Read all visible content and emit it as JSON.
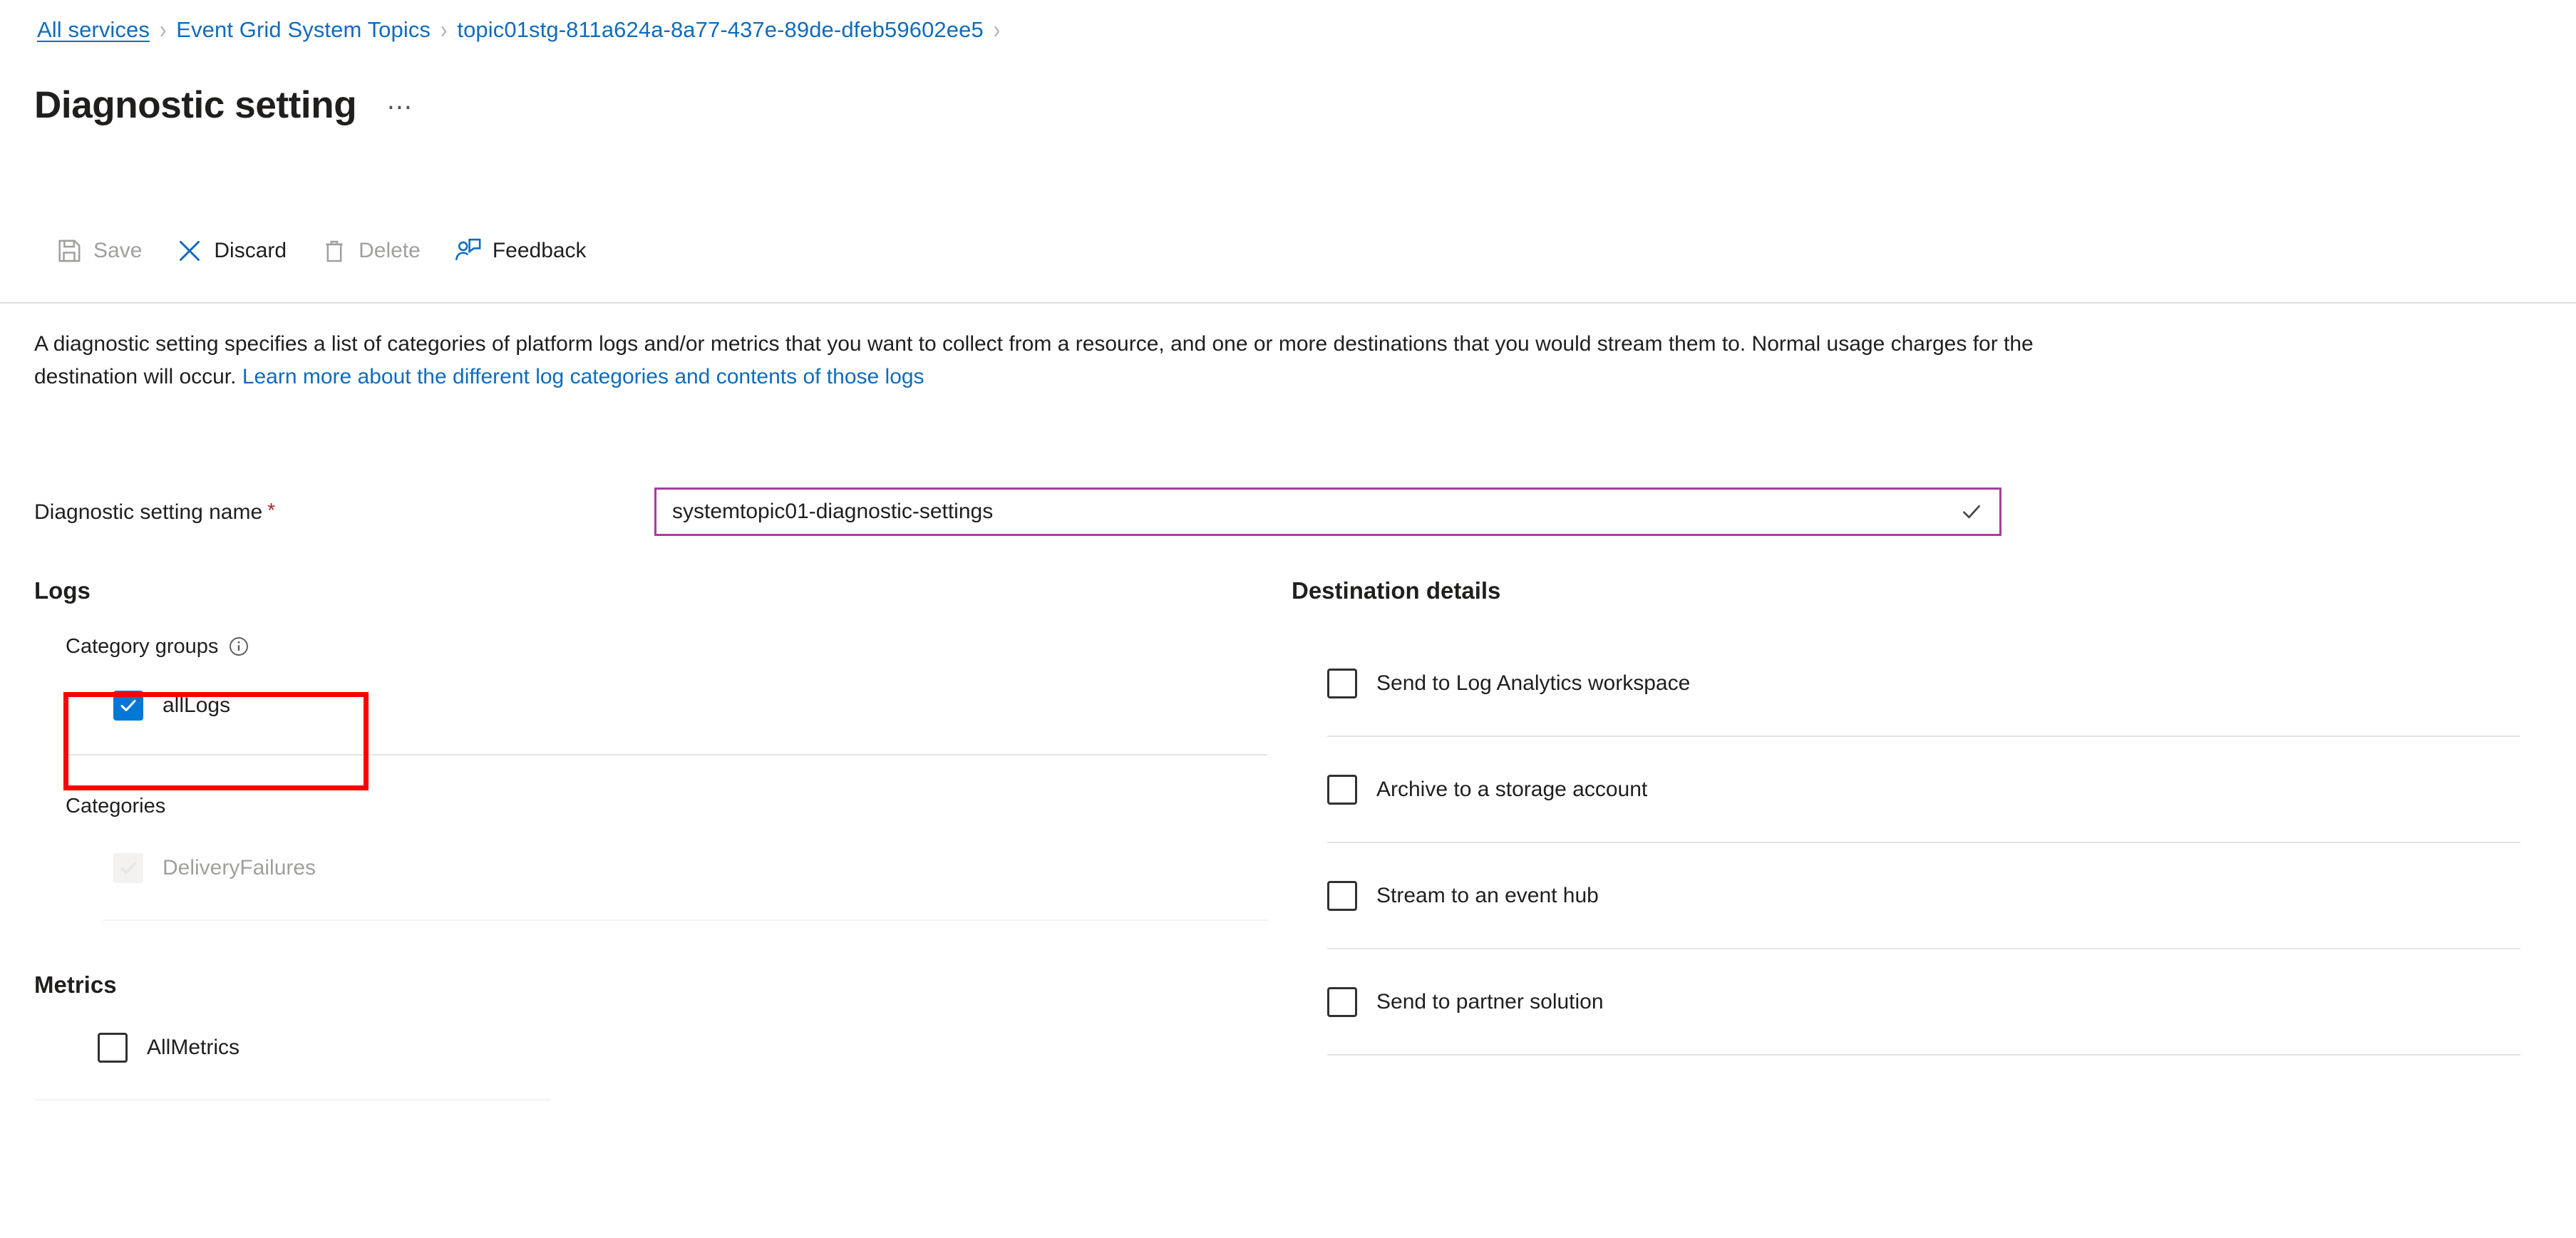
{
  "breadcrumb": {
    "items": [
      {
        "label": "All services",
        "hovered": true
      },
      {
        "label": "Event Grid System Topics",
        "hovered": false
      },
      {
        "label": "topic01stg-811a624a-8a77-437e-89de-dfeb59602ee5",
        "hovered": false
      }
    ],
    "separator": "›"
  },
  "header": {
    "title": "Diagnostic setting",
    "more_label": "⋯"
  },
  "toolbar": {
    "save_label": "Save",
    "discard_label": "Discard",
    "delete_label": "Delete",
    "feedback_label": "Feedback"
  },
  "description": {
    "part1": "A diagnostic setting specifies a list of categories of platform logs and/or metrics that you want to collect from a resource, and one or more destinations that you would stream them to. Normal usage charges for the destination will occur. ",
    "link": "Learn more about the different log categories and contents of those logs"
  },
  "name_field": {
    "label": "Diagnostic setting name",
    "required_marker": "*",
    "value": "systemtopic01-diagnostic-settings",
    "placeholder": "Diagnostic setting name",
    "valid": true
  },
  "logs": {
    "section_title": "Logs",
    "category_groups_label": "Category groups",
    "category_groups_info_icon": "info-icon",
    "category_groups": [
      {
        "label": "allLogs",
        "checked": true,
        "disabled": false,
        "highlighted": true
      }
    ],
    "categories_label": "Categories",
    "categories": [
      {
        "label": "DeliveryFailures",
        "checked": true,
        "disabled": true,
        "highlighted": false
      }
    ]
  },
  "metrics": {
    "section_title": "Metrics",
    "items": [
      {
        "label": "AllMetrics",
        "checked": false,
        "disabled": false
      }
    ]
  },
  "destination": {
    "section_title": "Destination details",
    "items": [
      {
        "label": "Send to Log Analytics workspace",
        "checked": false
      },
      {
        "label": "Archive to a storage account",
        "checked": false
      },
      {
        "label": "Stream to an event hub",
        "checked": false
      },
      {
        "label": "Send to partner solution",
        "checked": false
      }
    ]
  },
  "colors": {
    "link": "#0f6cbd",
    "accent": "#0078d4",
    "focus_border": "#a33ea0",
    "required": "#a4262c",
    "highlight": "#fe0000",
    "disabled_text": "#a19f9d"
  }
}
